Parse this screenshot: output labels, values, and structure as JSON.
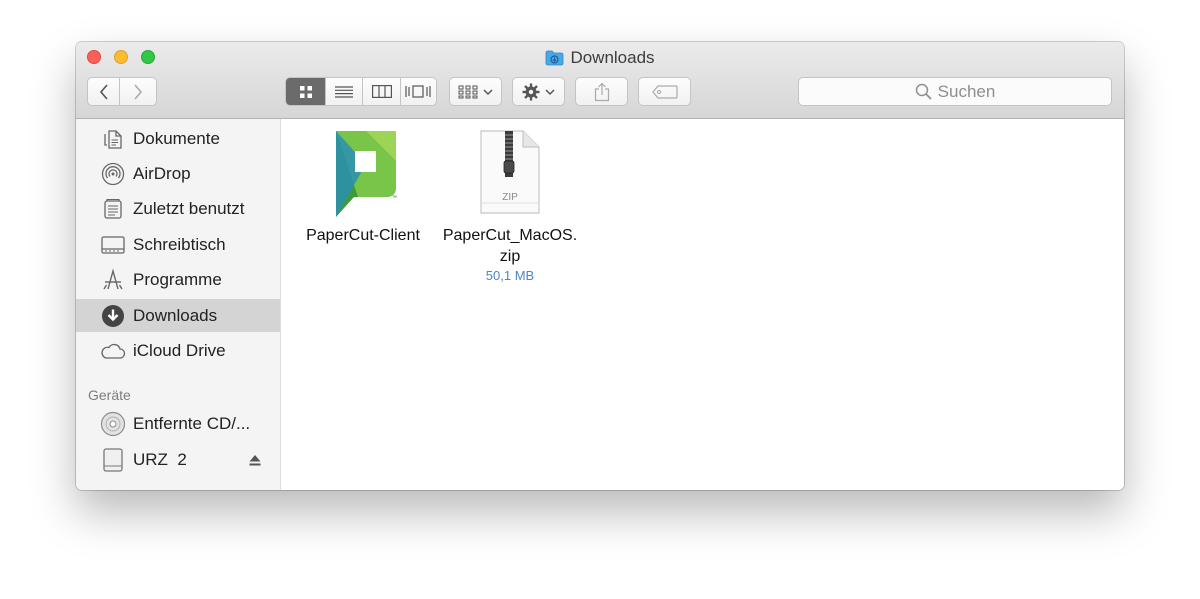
{
  "window": {
    "title": "Downloads"
  },
  "toolbar": {
    "back_icon": "chevron-left-icon",
    "forward_icon": "chevron-right-icon",
    "views": [
      "icon-view",
      "list-view",
      "column-view",
      "cover-flow-view"
    ],
    "arrange_icon": "arrange-grid-icon",
    "action_icon": "gear-icon",
    "share_icon": "share-icon",
    "tag_icon": "tag-icon",
    "search_placeholder": "Suchen"
  },
  "sidebar": {
    "favorites": [
      {
        "label": "Dokumente",
        "icon": "document-icon"
      },
      {
        "label": "AirDrop",
        "icon": "airdrop-icon"
      },
      {
        "label": "Zuletzt benutzt",
        "icon": "recents-icon"
      },
      {
        "label": "Schreibtisch",
        "icon": "desktop-icon"
      },
      {
        "label": "Programme",
        "icon": "applications-icon"
      },
      {
        "label": "Downloads",
        "icon": "download-icon",
        "selected": true
      },
      {
        "label": "iCloud Drive",
        "icon": "cloud-icon"
      }
    ],
    "devices_header": "Geräte",
    "devices": [
      {
        "label": "Entfernte CD/...",
        "icon": "disc-icon"
      },
      {
        "label": "URZ  2",
        "icon": "drive-icon",
        "eject": true
      }
    ]
  },
  "files": [
    {
      "name": "PaperCut-Client",
      "icon": "papercut-app-icon"
    },
    {
      "name_line1": "PaperCut_MacOS.",
      "name_line2": "zip",
      "size": "50,1 MB",
      "icon": "zip-file-icon",
      "badge": "ZIP"
    }
  ],
  "colors": {
    "close": "#fc5f57",
    "minimize": "#fdbc2e",
    "maximize": "#33c748",
    "selection": "#d4d4d4",
    "size_text": "#4a86c8",
    "papercut_green": "#6cc24a"
  }
}
